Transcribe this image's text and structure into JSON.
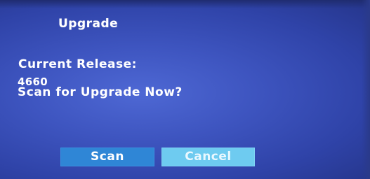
{
  "dialog": {
    "title": "Upgrade",
    "current_release_label": "Current Release:",
    "current_release_value": "4660",
    "prompt": "Scan for Upgrade Now?"
  },
  "buttons": {
    "scan_label": "Scan",
    "cancel_label": "Cancel"
  },
  "colors": {
    "background": "#3e55c0",
    "scan_button": "#2f86d6",
    "cancel_button": "#6ecbf0",
    "text": "#ffffff"
  }
}
